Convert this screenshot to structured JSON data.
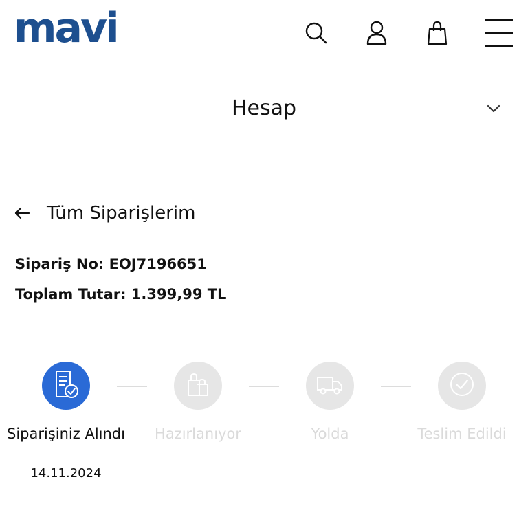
{
  "header": {
    "logo": "mavi",
    "icons": [
      "search-icon",
      "user-icon",
      "shopping-bag-icon",
      "menu-icon"
    ]
  },
  "account": {
    "title": "Hesap"
  },
  "back": {
    "label": "Tüm Siparişlerim"
  },
  "order": {
    "number_line": "Sipariş No: EOJ7196651",
    "total_line": "Toplam Tutar: 1.399,99 TL"
  },
  "steps": [
    {
      "label": "Siparişiniz Alındı",
      "date": "14.11.2024",
      "status": "active",
      "icon": "document-check-icon"
    },
    {
      "label": "Hazırlanıyor",
      "status": "inactive",
      "icon": "shopping-bags-icon"
    },
    {
      "label": "Yolda",
      "status": "inactive",
      "icon": "truck-icon"
    },
    {
      "label": "Teslim Edildi",
      "status": "inactive",
      "icon": "check-circle-icon"
    }
  ],
  "colors": {
    "brand": "#1d4f8f",
    "active_step": "#2a6ad6",
    "inactive_step": "#e6e6e6",
    "inactive_text": "#dadada"
  }
}
